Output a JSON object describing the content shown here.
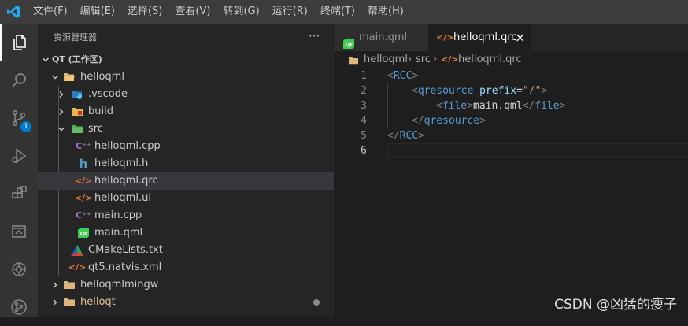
{
  "menubar": {
    "items": [
      "文件(F)",
      "编辑(E)",
      "选择(S)",
      "查看(V)",
      "转到(G)",
      "运行(R)",
      "终端(T)",
      "帮助(H)"
    ]
  },
  "activitybar": {
    "icons": [
      "explorer-icon",
      "search-icon",
      "source-control-icon",
      "run-debug-icon",
      "extensions-icon",
      "remote-explorer-icon",
      "chatgpt-icon",
      "git-graph-icon"
    ],
    "scm_badge": "1",
    "badge_color": "#007acc"
  },
  "sidebar": {
    "title": "资源管理器",
    "more_label": "···",
    "workspace": "QT (工作区)",
    "tree": [
      {
        "label": "helloqml",
        "icon": "folder-open-icon",
        "twisty": "open"
      },
      {
        "label": ".vscode",
        "icon": "vscode-folder-icon",
        "twisty": "closed"
      },
      {
        "label": "build",
        "icon": "folder-icon",
        "twisty": "closed"
      },
      {
        "label": "src",
        "icon": "src-folder-icon",
        "twisty": "open"
      },
      {
        "label": "helloqml.cpp",
        "icon": "cpp-file-icon"
      },
      {
        "label": "helloqml.h",
        "icon": "header-file-icon"
      },
      {
        "label": "helloqml.qrc",
        "icon": "xml-file-icon",
        "selected": true
      },
      {
        "label": "helloqml.ui",
        "icon": "xml-file-icon"
      },
      {
        "label": "main.cpp",
        "icon": "cpp-file-icon"
      },
      {
        "label": "main.qml",
        "icon": "qt-file-icon"
      },
      {
        "label": "CMakeLists.txt",
        "icon": "cmake-icon"
      },
      {
        "label": "qt5.natvis.xml",
        "icon": "xml-file-icon"
      },
      {
        "label": "helloqmlmingw",
        "icon": "folder-icon",
        "twisty": "closed"
      },
      {
        "label": "helloqt",
        "icon": "folder-icon",
        "twisty": "closed",
        "modified": true
      }
    ]
  },
  "editor": {
    "tabs": [
      {
        "label": "main.qml",
        "icon": "qt-file-icon",
        "active": false
      },
      {
        "label": "helloqml.qrc",
        "icon": "xml-file-icon",
        "active": true
      }
    ],
    "close_label": "×",
    "breadcrumbs": [
      "helloqml",
      "src",
      "helloqml.qrc"
    ],
    "breadcrumb_sep": "›",
    "line_numbers": [
      "1",
      "2",
      "3",
      "4",
      "5",
      "6"
    ],
    "code": {
      "l1": {
        "open": "<",
        "tag": "RCC",
        "close": ">"
      },
      "l2": {
        "open": "<",
        "tag": "qresource",
        "attr": "prefix",
        "eq": "=",
        "val": "\"/\"",
        "close": ">"
      },
      "l3": {
        "open": "<",
        "tag": "file",
        "close": ">",
        "text": "main.qml",
        "open2": "</",
        "tag2": "file",
        "close2": ">"
      },
      "l4": {
        "open": "</",
        "tag": "qresource",
        "close": ">"
      },
      "l5": {
        "open": "</",
        "tag": "RCC",
        "close": ">"
      }
    }
  },
  "watermark": "CSDN @凶猛的瘦子",
  "colors": {
    "accent": "#007acc",
    "tag": "#569cd6",
    "attribute": "#9cdcfe",
    "string": "#ce9178",
    "text": "#d4d4d4",
    "xml_icon": "#e37933",
    "cpp_icon": "#a074c4",
    "qt_icon": "#41cd52"
  }
}
